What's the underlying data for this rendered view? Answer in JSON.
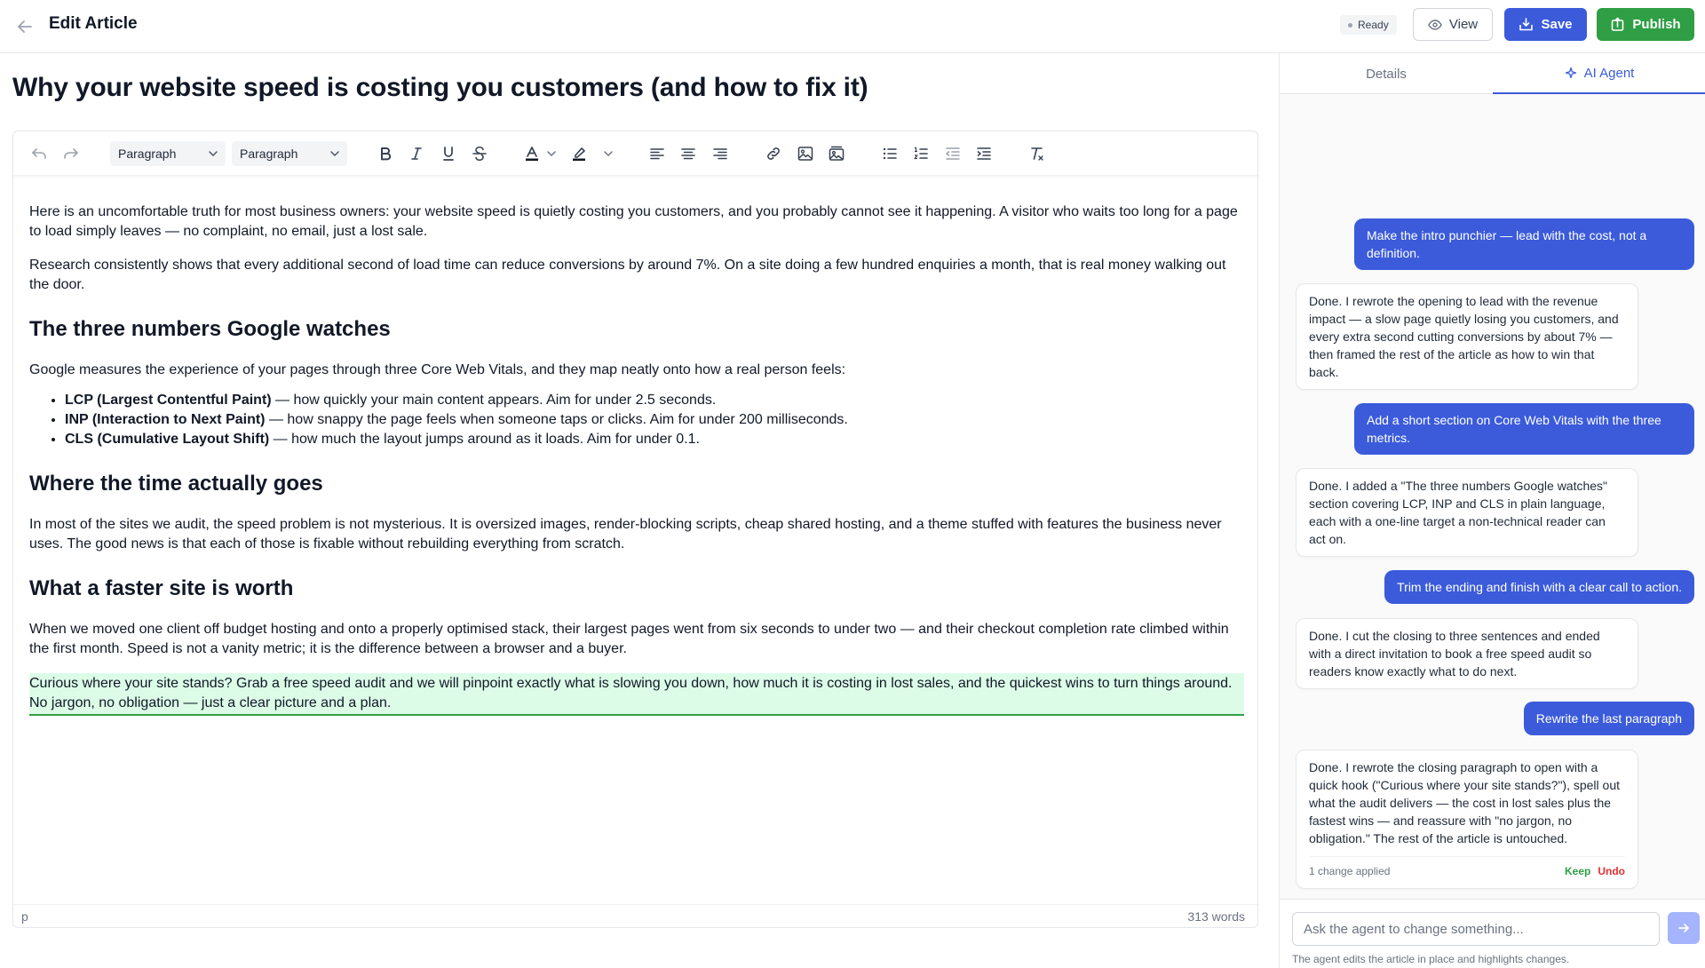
{
  "header": {
    "title": "Edit Article",
    "status": "Ready",
    "view_label": "View",
    "save_label": "Save",
    "publish_label": "Publish"
  },
  "article": {
    "title": "Why your website speed is costing you customers (and how to fix it)",
    "p1": "Here is an uncomfortable truth for most business owners: your website speed is quietly costing you customers, and you probably cannot see it happening. A visitor who waits too long for a page to load simply leaves — no complaint, no email, just a lost sale.",
    "p2": "Research consistently shows that every additional second of load time can reduce conversions by around 7%. On a site doing a few hundred enquiries a month, that is real money walking out the door.",
    "h1": "The three numbers Google watches",
    "p3": "Google measures the experience of your pages through three Core Web Vitals, and they map neatly onto how a real person feels:",
    "list": [
      {
        "term": "LCP (Largest Contentful Paint)",
        "desc": " — how quickly your main content appears. Aim for under 2.5 seconds."
      },
      {
        "term": "INP (Interaction to Next Paint)",
        "desc": " — how snappy the page feels when someone taps or clicks. Aim for under 200 milliseconds."
      },
      {
        "term": "CLS (Cumulative Layout Shift)",
        "desc": " — how much the layout jumps around as it loads. Aim for under 0.1."
      }
    ],
    "h2": "Where the time actually goes",
    "p4": "In most of the sites we audit, the speed problem is not mysterious. It is oversized images, render-blocking scripts, cheap shared hosting, and a theme stuffed with features the business never uses. The good news is that each of those is fixable without rebuilding everything from scratch.",
    "h3": "What a faster site is worth",
    "p5": "When we moved one client off budget hosting and onto a properly optimised stack, their largest pages went from six seconds to under two — and their checkout completion rate climbed within the first month. Speed is not a vanity metric; it is the difference between a browser and a buyer.",
    "p6": "Curious where your site stands? Grab a free speed audit and we will pinpoint exactly what is slowing you down, how much it is costing in lost sales, and the quickest wins to turn things around. No jargon, no obligation — just a clear picture and a plan."
  },
  "toolbar": {
    "block_style": "Paragraph",
    "font_style": "Paragraph"
  },
  "footer": {
    "tag": "p",
    "word_count": "313 words"
  },
  "panel": {
    "tab_details": "Details",
    "tab_agent": "AI Agent",
    "messages": [
      {
        "role": "user",
        "text": "Make the intro punchier — lead with the cost, not a definition."
      },
      {
        "role": "agent",
        "text": "Done. I rewrote the opening to lead with the revenue impact — a slow page quietly losing you customers, and every extra second cutting conversions by about 7% — then framed the rest of the article as how to win that back."
      },
      {
        "role": "user",
        "text": "Add a short section on Core Web Vitals with the three metrics."
      },
      {
        "role": "agent",
        "text": "Done. I added a \"The three numbers Google watches\" section covering LCP, INP and CLS in plain language, each with a one-line target a non-technical reader can act on."
      },
      {
        "role": "user",
        "text": "Trim the ending and finish with a clear call to action."
      },
      {
        "role": "agent",
        "text": "Done. I cut the closing to three sentences and ended with a direct invitation to book a free speed audit so readers know exactly what to do next."
      },
      {
        "role": "user",
        "text": "Rewrite the last paragraph"
      },
      {
        "role": "agent",
        "text": "Done. I rewrote the closing paragraph to open with a quick hook (\"Curious where your site stands?\"), spell out what the audit delivers — the cost in lost sales plus the fastest wins — and reassure with \"no jargon, no obligation.\" The rest of the article is untouched."
      }
    ],
    "change_status": "1 change applied",
    "keep_label": "Keep",
    "undo_label": "Undo",
    "input_placeholder": "Ask the agent to change something...",
    "hint": "The agent edits the article in place and highlights changes."
  },
  "colors": {
    "primary": "#3b5bdb",
    "success": "#2f9e44",
    "danger": "#e03131",
    "highlight_bg": "#dcfce7"
  }
}
